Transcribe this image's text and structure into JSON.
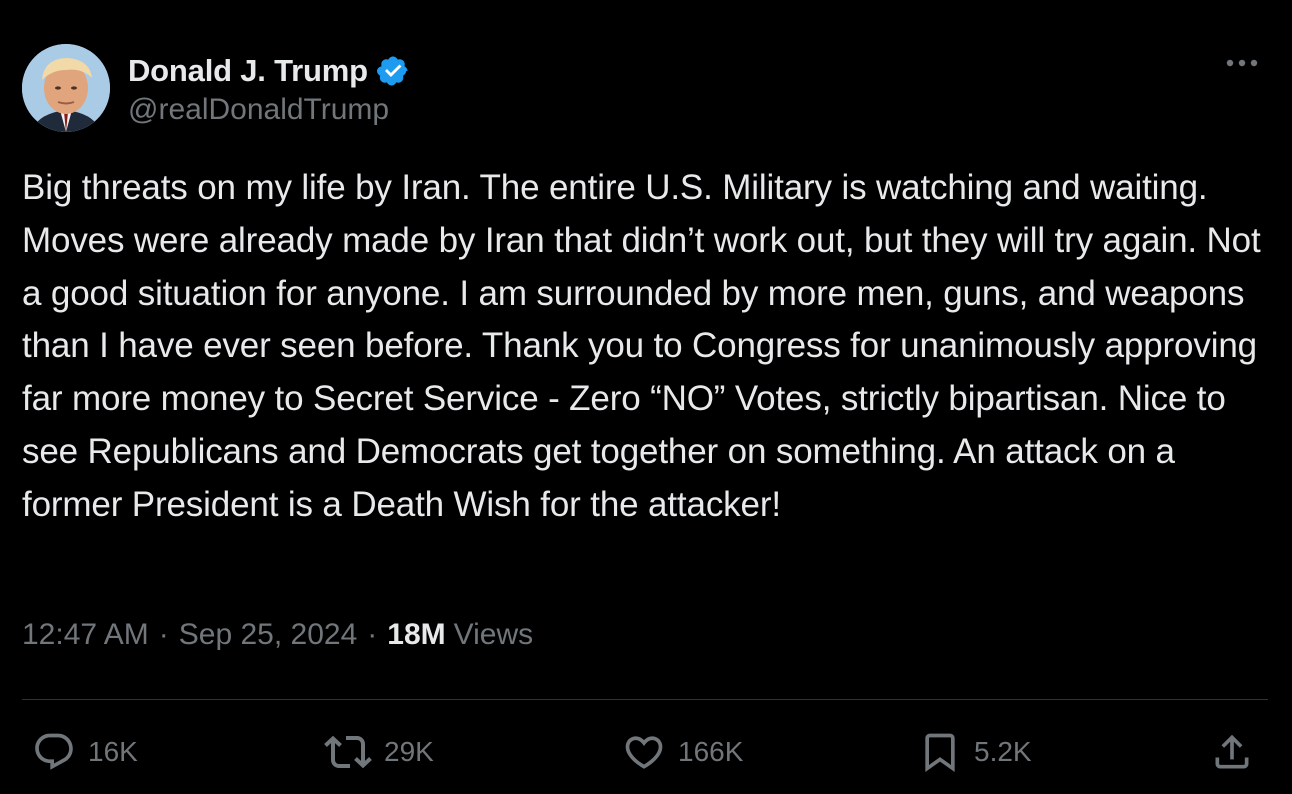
{
  "author": {
    "display_name": "Donald J. Trump",
    "handle": "@realDonaldTrump",
    "verified": true
  },
  "post": {
    "text": "Big threats on my life by Iran. The entire U.S. Military is watching and waiting. Moves were already made by Iran that didn’t work out, but they will try again. Not a good situation for anyone. I am surrounded by more men, guns, and weapons than I have ever seen before. Thank you to Congress for unanimously approving far more money to Secret Service - Zero “NO” Votes, strictly bipartisan. Nice to see Republicans and Democrats get together on something. An attack on a former President is a Death Wish for the attacker!",
    "time": "12:47 AM",
    "date": "Sep 25, 2024",
    "separator": "·",
    "views_count": "18M",
    "views_label": "Views"
  },
  "actions": {
    "replies": "16K",
    "reposts": "29K",
    "likes": "166K",
    "bookmarks": "5.2K"
  },
  "icons": {
    "more": "more-horizontal-icon",
    "reply": "reply-icon",
    "repost": "repost-icon",
    "like": "heart-icon",
    "bookmark": "bookmark-icon",
    "share": "share-icon",
    "verified": "verified-badge-icon"
  },
  "colors": {
    "background": "#000000",
    "text_primary": "#e7e9ea",
    "text_secondary": "#71767b",
    "verified_blue": "#1d9bf0",
    "divider": "#2f3336"
  }
}
